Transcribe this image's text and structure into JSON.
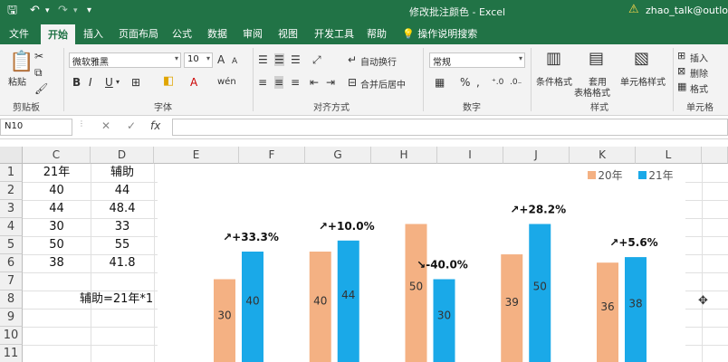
{
  "titlebar": {
    "save_icon": "save-icon",
    "undo_icon": "undo-icon",
    "redo_icon": "redo-icon",
    "doc_title": "修改批注颜色 - Excel",
    "user": "zhao_talk@outlook"
  },
  "tabs": [
    "文件",
    "开始",
    "插入",
    "页面布局",
    "公式",
    "数据",
    "审阅",
    "视图",
    "开发工具",
    "帮助"
  ],
  "active_tab": "开始",
  "tell_me": "操作说明搜索",
  "ribbon": {
    "clipboard": {
      "paste": "粘贴",
      "label": "剪贴板"
    },
    "font": {
      "name": "微软雅黑",
      "size": "10",
      "bold": "B",
      "italic": "I",
      "underline": "U",
      "grow": "A",
      "shrink": "A",
      "wen": "wén",
      "label": "字体"
    },
    "alignment": {
      "wrap": "自动换行",
      "merge": "合并后居中",
      "label": "对齐方式"
    },
    "number": {
      "format": "常规",
      "percent": "%",
      "comma": ",",
      "label": "数字"
    },
    "styles": {
      "conditional": "条件格式",
      "table1": "套用",
      "table2": "表格格式",
      "cell_styles": "单元格样式",
      "label": "样式"
    },
    "cells": {
      "insert": "插入",
      "delete": "删除",
      "format": "格式",
      "label": "单元格"
    }
  },
  "formula_bar": {
    "name_box": "N10",
    "cancel": "✕",
    "enter": "✓",
    "fx": "fx",
    "value": ""
  },
  "columns": [
    "C",
    "D",
    "E",
    "F",
    "G",
    "H",
    "I",
    "J",
    "K",
    "L"
  ],
  "rows": [
    "1",
    "2",
    "3",
    "4",
    "5",
    "6",
    "7",
    "8",
    "9",
    "10",
    "11"
  ],
  "cells": {
    "C1": "21年",
    "D1": "辅助",
    "C2": "40",
    "D2": "44",
    "C3": "44",
    "D3": "48.4",
    "C4": "30",
    "D4": "33",
    "C5": "50",
    "D5": "55",
    "C6": "38",
    "D6": "41.8",
    "D8": "辅助=21年*1"
  },
  "chart_data": {
    "type": "bar",
    "categories": [
      "",
      "",
      "",
      "",
      ""
    ],
    "series": [
      {
        "name": "20年",
        "values": [
          30,
          40,
          50,
          39,
          36
        ]
      },
      {
        "name": "21年",
        "values": [
          40,
          44,
          30,
          50,
          38
        ]
      }
    ],
    "annotations": [
      "↗+33.3%",
      "↗+10.0%",
      "↘-40.0%",
      "↗+28.2%",
      "↗+5.6%"
    ],
    "colors": {
      "20年": "#f4b183",
      "21年": "#1aa9e8"
    },
    "legend": "top-right",
    "grid": false,
    "title": ""
  }
}
